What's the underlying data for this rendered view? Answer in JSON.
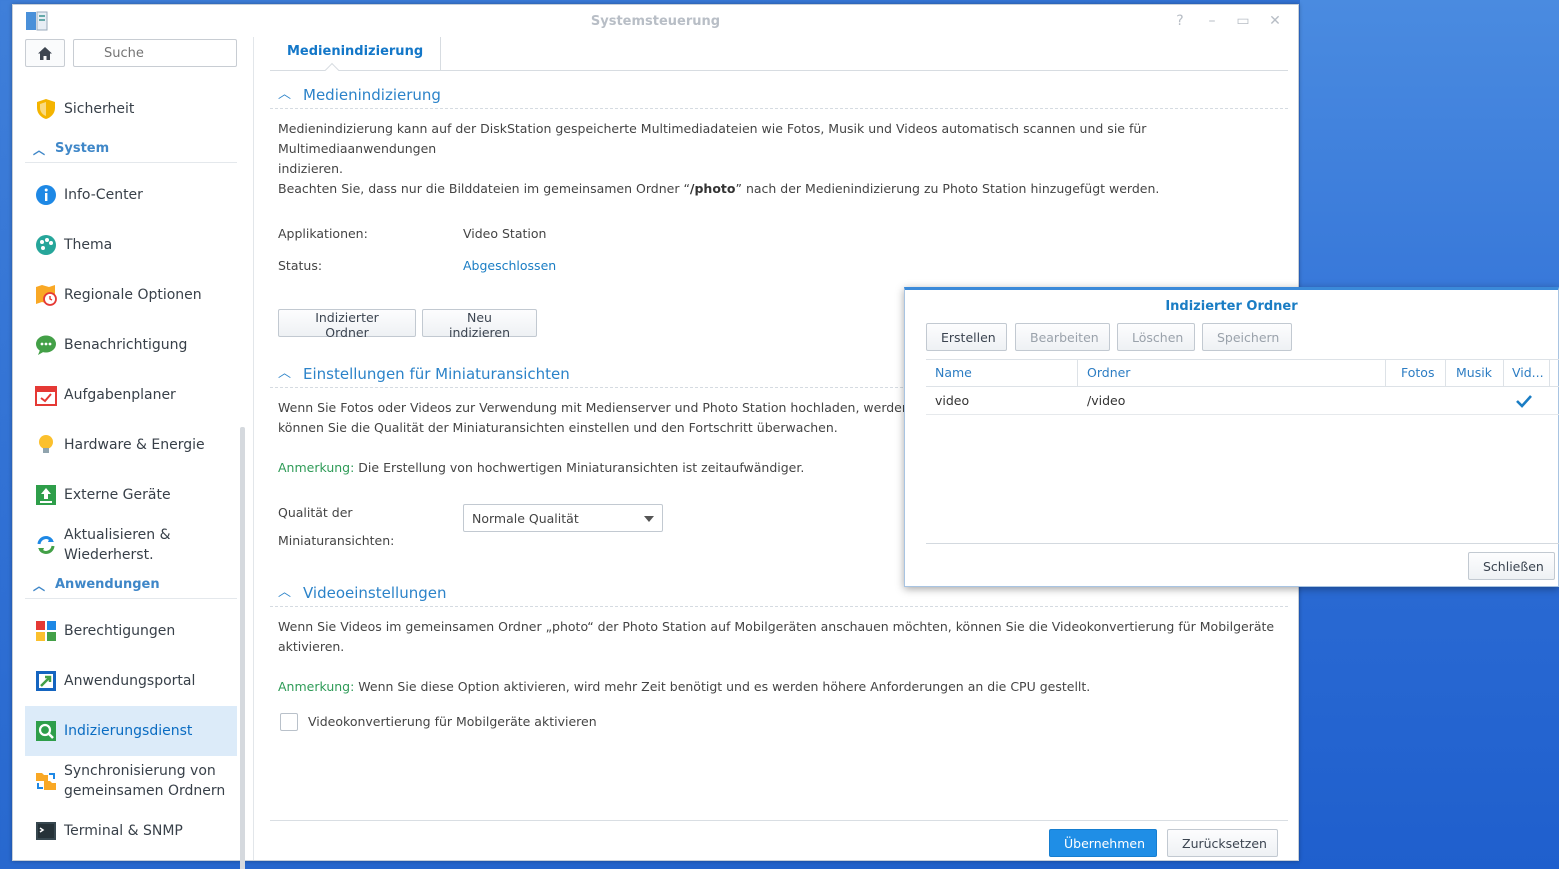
{
  "window": {
    "title": "Systemsteuerung",
    "help": "?",
    "minimize": "–",
    "maximize": "▭",
    "close": "✕"
  },
  "sidebar": {
    "search_placeholder": "Suche",
    "items_top": [
      {
        "label": "Sicherheit"
      }
    ],
    "section_system": "System",
    "system_items": [
      {
        "label": "Info-Center"
      },
      {
        "label": "Thema"
      },
      {
        "label": "Regionale Optionen"
      },
      {
        "label": "Benachrichtigung"
      },
      {
        "label": "Aufgabenplaner"
      },
      {
        "label": "Hardware & Energie"
      },
      {
        "label": "Externe Geräte"
      },
      {
        "label": "Aktualisieren &",
        "label2": "Wiederherst."
      }
    ],
    "section_apps": "Anwendungen",
    "app_items": [
      {
        "label": "Berechtigungen"
      },
      {
        "label": "Anwendungsportal"
      },
      {
        "label": "Indizierungsdienst"
      },
      {
        "label": "Synchronisierung von",
        "label2": "gemeinsamen Ordnern"
      },
      {
        "label": "Terminal & SNMP"
      }
    ]
  },
  "main": {
    "tab": "Medienindizierung",
    "media_section": {
      "title": "Medienindizierung",
      "desc1": "Medienindizierung kann auf der DiskStation gespeicherte Multimediadateien wie Fotos, Musik und Videos automatisch scannen und sie für Multimediaanwendungen",
      "desc1b": "indizieren.",
      "desc2_pre": "Beachten Sie, dass nur die Bilddateien im gemeinsamen Ordner “",
      "desc2_bold": "/photo",
      "desc2_post": "” nach der Medienindizierung zu Photo Station hinzugefügt werden.",
      "apps_label": "Applikationen:",
      "apps_value": "Video Station",
      "status_label": "Status:",
      "status_value": "Abgeschlossen",
      "btn_indexed_folder": "Indizierter Ordner",
      "btn_reindex": "Neu indizieren"
    },
    "thumb_section": {
      "title": "Einstellungen für Miniaturansichten",
      "desc1": "Wenn Sie Fotos oder Videos zur Verwendung mit Medienserver und Photo Station hochladen, werden Mi",
      "desc1b": "können Sie die Qualität der Miniaturansichten einstellen und den Fortschritt überwachen.",
      "note_label": "Anmerkung:",
      "note_text": " Die Erstellung von hochwertigen Miniaturansichten ist zeitaufwändiger.",
      "quality_label1": "Qualität der",
      "quality_label2": "Miniaturansichten:",
      "quality_value": "Normale Qualität"
    },
    "video_section": {
      "title": "Videoeinstellungen",
      "desc1": "Wenn Sie Videos im gemeinsamen Ordner „photo“ der Photo Station auf Mobilgeräten anschauen möchten, können Sie die Videokonvertierung für Mobilgeräte",
      "desc1b": "aktivieren.",
      "note_label": "Anmerkung:",
      "note_text": " Wenn Sie diese Option aktivieren, wird mehr Zeit benötigt und es werden höhere Anforderungen an die CPU gestellt.",
      "checkbox_label": "Videokonvertierung für Mobilgeräte aktivieren",
      "checkbox_checked": false
    },
    "footer": {
      "apply": "Übernehmen",
      "reset": "Zurücksetzen"
    }
  },
  "dialog": {
    "title": "Indizierter Ordner",
    "toolbar": {
      "create": "Erstellen",
      "edit": "Bearbeiten",
      "delete": "Löschen",
      "save": "Speichern"
    },
    "columns": {
      "name": "Name",
      "folder": "Ordner",
      "photos": "Fotos",
      "music": "Musik",
      "video": "Vid..."
    },
    "rows": [
      {
        "name": "video",
        "folder": "/video",
        "photos": false,
        "music": false,
        "video": true
      }
    ],
    "close": "Schließen"
  },
  "colors": {
    "accent": "#1f8ee6",
    "link": "#1a7dc4",
    "note": "#2e9b57",
    "sidebar_active_bg": "#dcebf9"
  },
  "icons": {
    "app": "control-panel-icon",
    "home": "home-icon",
    "search": "search-icon",
    "checkmark": "checkmark-icon"
  }
}
